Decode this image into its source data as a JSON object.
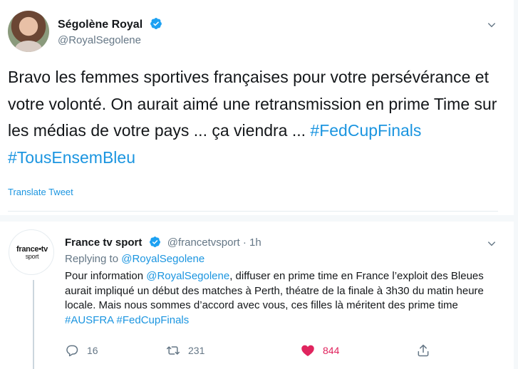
{
  "main_tweet": {
    "author_name": "Ségolène Royal",
    "author_handle": "@RoyalSegolene",
    "text_plain": "Bravo les femmes sportives françaises pour votre persévérance et votre volonté. On aurait aimé une retransmission en prime Time sur les médias de votre pays ... ça viendra ... ",
    "hashtag_1": "#FedCupFinals",
    "hashtag_2": "#TousEnsemBleu",
    "translate_label": "Translate Tweet"
  },
  "reply_tweet": {
    "logo_text": "france•tv",
    "logo_sub": "sport",
    "author_name": "France tv sport",
    "author_handle_time": "@francetvsport · 1h",
    "replying_prefix": "Replying to ",
    "replying_to": "@RoyalSegolene",
    "text_1": "Pour information ",
    "text_mention": "@RoyalSegolene",
    "text_2": ", diffuser en prime time en France l’exploit des Bleues aurait impliqué un début des matches à Perth, théatre de la finale à 3h30 du matin heure locale. Mais nous sommes d’accord avec vous, ces filles là méritent des prime time ",
    "hashtag_1": "#AUSFRA",
    "hashtag_2": "#FedCupFinals",
    "reply_count": "16",
    "retweet_count": "231",
    "like_count": "844"
  },
  "colors": {
    "accent": "#1b95e0",
    "verified": "#1da1f2",
    "like": "#e0245e",
    "muted": "#657786"
  },
  "icons": [
    "verified-badge-icon",
    "chevron-down-icon",
    "reply-icon",
    "retweet-icon",
    "heart-icon",
    "share-icon"
  ]
}
